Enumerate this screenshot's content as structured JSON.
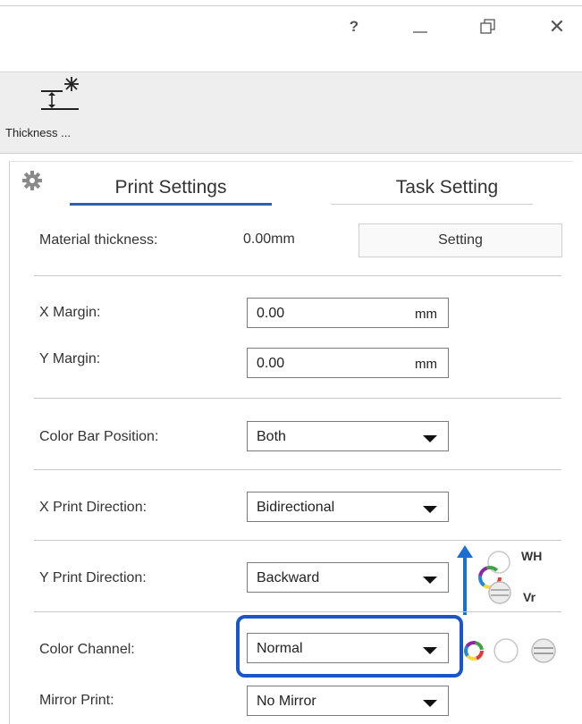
{
  "window": {
    "help_label": "?",
    "close_label": "✕"
  },
  "toolbar": {
    "thickness_label": "Thickness ..."
  },
  "tabs": [
    {
      "label": "Print Settings",
      "selected": true
    },
    {
      "label": "Task Setting",
      "selected": false
    }
  ],
  "print_settings": {
    "material_thickness": {
      "label": "Material thickness:",
      "value": "0.00mm",
      "button_label": "Setting"
    },
    "x_margin": {
      "label": "X Margin:",
      "value": "0.00",
      "unit": "mm"
    },
    "y_margin": {
      "label": "Y Margin:",
      "value": "0.00",
      "unit": "mm"
    },
    "color_bar_position": {
      "label": "Color Bar Position:",
      "value": "Both"
    },
    "x_print_direction": {
      "label": "X Print Direction:",
      "value": "Bidirectional"
    },
    "y_print_direction": {
      "label": "Y Print Direction:",
      "value": "Backward",
      "wh_label": "WH",
      "vr_label": "Vr"
    },
    "color_channel": {
      "label": "Color Channel:",
      "value": "Normal"
    },
    "mirror_print": {
      "label": "Mirror Print:",
      "value": "No Mirror"
    }
  },
  "colors": {
    "accent": "#2a64b0",
    "highlight": "#1a56c9",
    "arrow": "#1a6fd1"
  }
}
